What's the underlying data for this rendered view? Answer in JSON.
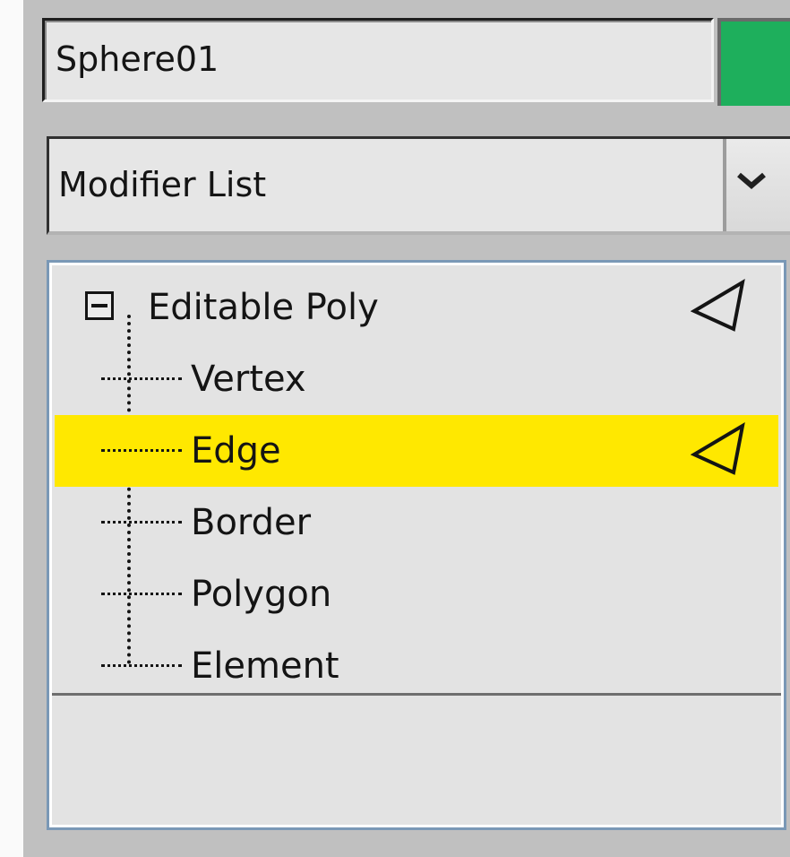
{
  "object": {
    "name": "Sphere01",
    "color": "#1eaf5c"
  },
  "modifier_list": {
    "label": "Modifier List",
    "dropdown_icon": "chevron-down-icon"
  },
  "stack": {
    "base_object": {
      "label": "Editable Poly",
      "expanded": true,
      "collapse_icon": "minus-box-icon",
      "show_icon": "light-bulb-cone-icon"
    },
    "subobjects": [
      {
        "label": "Vertex",
        "selected": false
      },
      {
        "label": "Edge",
        "selected": true
      },
      {
        "label": "Border",
        "selected": false
      },
      {
        "label": "Polygon",
        "selected": false
      },
      {
        "label": "Element",
        "selected": false
      }
    ],
    "selection_color": "#ffe800"
  }
}
